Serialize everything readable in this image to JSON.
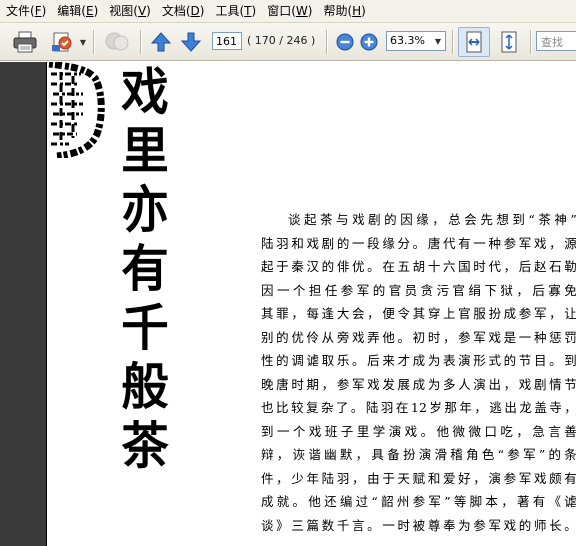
{
  "menu": [
    {
      "label": "文件(",
      "key": "F",
      "end": ")"
    },
    {
      "label": "编辑(",
      "key": "E",
      "end": ")"
    },
    {
      "label": "视图(",
      "key": "V",
      "end": ")"
    },
    {
      "label": "文档(",
      "key": "D",
      "end": ")"
    },
    {
      "label": "工具(",
      "key": "T",
      "end": ")"
    },
    {
      "label": "窗口(",
      "key": "W",
      "end": ")"
    },
    {
      "label": "帮助(",
      "key": "H",
      "end": ")"
    }
  ],
  "toolbar": {
    "page_number": "161",
    "page_total": "( 170 / 246 )",
    "zoom": "63.3%",
    "search_placeholder": "查找"
  },
  "page": {
    "vertical_title": [
      "戏",
      "里",
      "亦",
      "有",
      "千",
      "般",
      "茶"
    ],
    "paragraph_lines": [
      "谈起茶与戏剧的因缘，总会先想到“茶神”",
      "陆羽和戏剧的一段缘分。唐代有一种参军戏，源",
      "起于秦汉的俳优。在五胡十六国时代，后赵石勒",
      "因一个担任参军的官员贪污官绢下狱，后寡免",
      "其罪，每逢大会，便令其穿上官服扮成参军，让",
      "别的优伶从旁戏弄他。初时，参军戏是一种惩罚",
      "性的调谑取乐。后来才成为表演形式的节目。到",
      "晚唐时期，参军戏发展成为多人演出，戏剧情节",
      "也比较复杂了。陆羽在12岁那年，逃出龙盖寺，",
      "到一个戏班子里学演戏。他微微口吃，急言善",
      "辩，诙谐幽默，具备扮演滑稽角色“参军”的条",
      "件，少年陆羽，由于天赋和爱好，演参军戏颇有",
      "成就。他还编过“韶州参军”等脚本，著有《谑",
      "谈》三篇数千言。一时被尊奉为参军戏的师长。"
    ]
  }
}
